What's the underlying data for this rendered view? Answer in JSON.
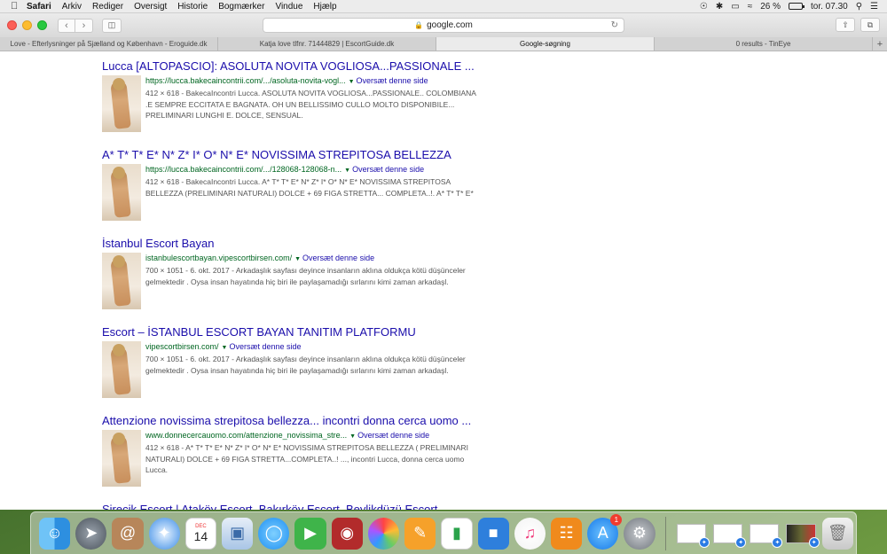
{
  "menubar": {
    "app_name": "Safari",
    "items": [
      "Arkiv",
      "Rediger",
      "Oversigt",
      "Historie",
      "Bogmærker",
      "Vindue",
      "Hjælp"
    ],
    "battery": "26 %",
    "clock": "tor. 07.30"
  },
  "toolbar": {
    "url": "google.com"
  },
  "tabs": [
    {
      "label": "Love - Efterlysninger på Sjælland og København - Eroguide.dk",
      "active": false
    },
    {
      "label": "Katja love tlfnr. 71444829 | EscortGuide.dk",
      "active": false
    },
    {
      "label": "Google-søgning",
      "active": true
    },
    {
      "label": "0 results - TinEye",
      "active": false
    }
  ],
  "results": [
    {
      "title": "Lucca [ALTOPASCIO]: ASOLUTA NOVITA VOGLIOSA...PASSIONALE ...",
      "url": "https://lucca.bakecaincontrii.com/.../asoluta-novita-vogl...",
      "translate": "Oversæt denne side",
      "snippet": "412 × 618 - BakecaIncontri Lucca. ASOLUTA NOVITA VOGLIOSA...PASSIONALE.. COLOMBIANA .E SEMPRE ECCITATA E BAGNATA. OH UN BELLISSIMO CULLO MOLTO DISPONIBILE... PRELIMINARI LUNGHI E. DOLCE, SENSUAL."
    },
    {
      "title": "A* T* T* E* N* Z* I* O* N* E* NOVISSIMA STREPITOSA BELLEZZA",
      "url": "https://lucca.bakecaincontrii.com/.../128068-128068-n...",
      "translate": "Oversæt denne side",
      "snippet": "412 × 618 - BakecaIncontri Lucca. A* T* T* E* N* Z* I* O* N* E* NOVISSIMA STREPITOSA BELLEZZA (PRELIMINARI NATURALI) DOLCE + 69 FIGA STRETTA... COMPLETA..!. A* T* T* E*"
    },
    {
      "title": "İstanbul Escort Bayan",
      "url": "istanbulescortbayan.vipescortbirsen.com/",
      "translate": "Oversæt denne side",
      "snippet": "700 × 1051 - 6. okt. 2017 - Arkadaşlık sayfası deyince insanların aklına oldukça kötü düşünceler gelmektedir . Oysa insan hayatında hiç biri ile paylaşamadığı sırlarını kimi zaman arkadaşl."
    },
    {
      "title": "Escort – İSTANBUL ESCORT BAYAN TANITIM PLATFORMU",
      "url": "vipescortbirsen.com/",
      "translate": "Oversæt denne side",
      "snippet": "700 × 1051 - 6. okt. 2017 - Arkadaşlık sayfası deyince insanların aklına oldukça kötü düşünceler gelmektedir . Oysa insan hayatında hiç biri ile paylaşamadığı sırlarını kimi zaman arkadaşl."
    },
    {
      "title": "Attenzione novissima strepitosa bellezza... incontri donna cerca uomo ...",
      "url": "www.donnecercauomo.com/attenzione_novissima_stre...",
      "translate": "Oversæt denne side",
      "snippet": "412 × 618 - A* T* T* E* N* Z* I* O* N* E* NOVISSIMA STREPITOSA BELLEZZA ( PRELIMINARI NATURALI) DOLCE + 69 FIGA STRETTA...COMPLETA..! ..., incontri Lucca, donna cerca uomo Lucca."
    },
    {
      "title": "Sirecik Escort | Ataköy Escort, Bakırköy Escort, Beylikdüzü Escort",
      "url": "",
      "translate": "",
      "snippet": ""
    }
  ],
  "dock": {
    "calendar_month": "DEC",
    "calendar_day": "14",
    "appstore_badge": "1",
    "apps": [
      "finder-icon",
      "launchpad-icon",
      "contacts-icon",
      "safari-icon",
      "calendar-icon",
      "preview-icon",
      "messages-icon",
      "facetime-icon",
      "photobooth-icon",
      "photos-icon",
      "pages-icon",
      "numbers-icon",
      "keynote-icon",
      "music-icon",
      "books-icon",
      "appstore-icon",
      "settings-icon"
    ]
  }
}
